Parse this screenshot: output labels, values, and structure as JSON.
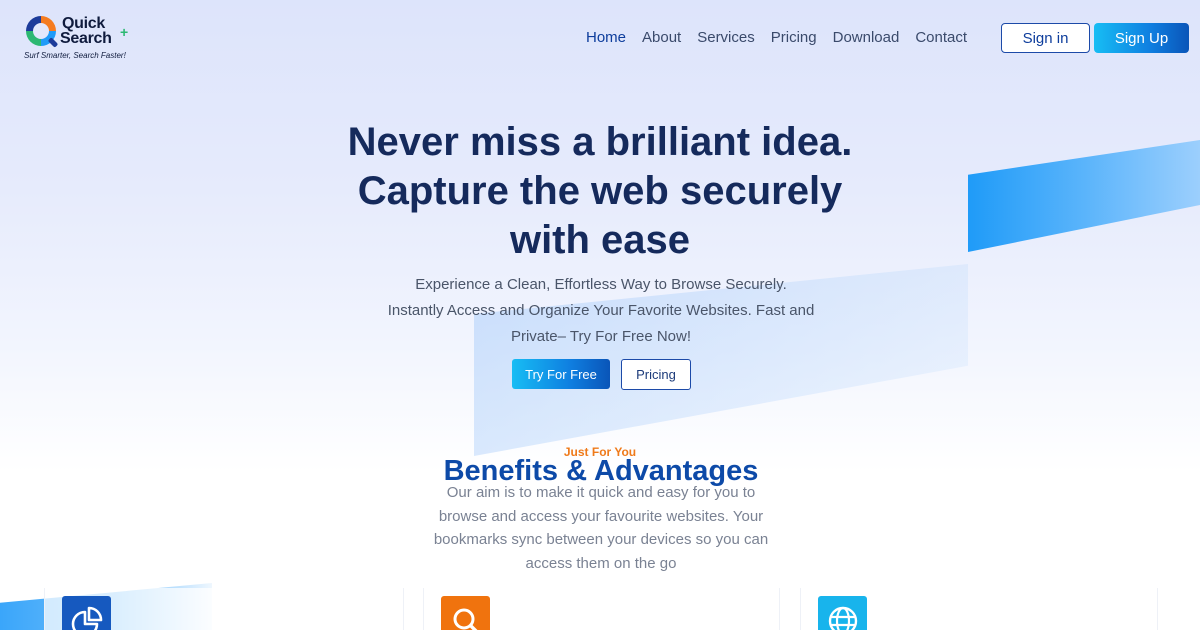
{
  "brand": {
    "name_line1": "Quick",
    "name_line2": "Search",
    "plus": "+",
    "tagline": "Surf Smarter, Search Faster!"
  },
  "nav": {
    "items": [
      {
        "label": "Home",
        "active": true
      },
      {
        "label": "About",
        "active": false
      },
      {
        "label": "Services",
        "active": false
      },
      {
        "label": "Pricing",
        "active": false
      },
      {
        "label": "Download",
        "active": false
      },
      {
        "label": "Contact",
        "active": false
      }
    ],
    "sign_in": "Sign in",
    "sign_up": "Sign Up"
  },
  "hero": {
    "title_line1": "Never miss a brilliant idea.",
    "title_line2": "Capture the web securely",
    "title_line3": "with ease",
    "subtitle": "Experience a Clean, Effortless Way to Browse Securely. Instantly Access and Organize Your Favorite Websites. Fast and Private– Try For Free Now!",
    "cta_primary": "Try For Free",
    "cta_secondary": "Pricing"
  },
  "benefits": {
    "eyebrow": "Just For You",
    "title": "Benefits & Advantages",
    "description": "Our aim is to make it quick and easy for you to browse and access your favourite websites. Your bookmarks sync between your devices so you can access them on the go",
    "cards": [
      {
        "icon": "pie-chart-icon",
        "color": "#1659bf"
      },
      {
        "icon": "search-icon",
        "color": "#f0730e"
      },
      {
        "icon": "globe-icon",
        "color": "#18b4ec"
      }
    ]
  },
  "colors": {
    "primary_dark": "#152a5c",
    "primary_blue": "#0d4aa8",
    "accent_orange": "#ef7a1a",
    "gradient_start": "#17bdf4",
    "gradient_end": "#0a55b8"
  }
}
